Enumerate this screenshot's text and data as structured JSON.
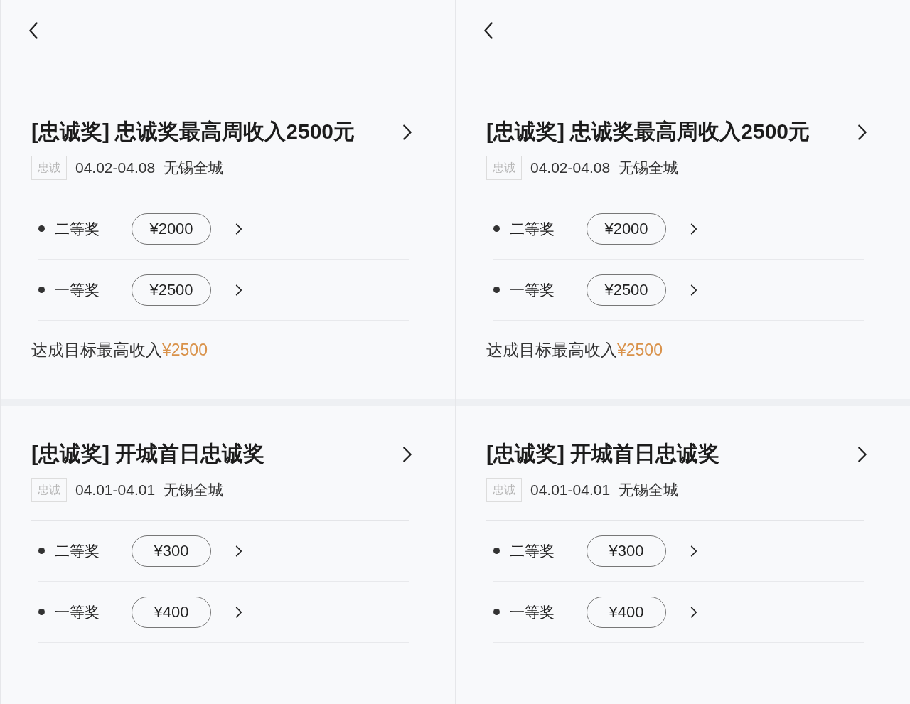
{
  "screens": [
    {
      "cards": [
        {
          "title": "[忠诚奖] 忠诚奖最高周收入2500元",
          "tag": "忠诚",
          "dates": "04.02-04.08",
          "area": "无锡全城",
          "tiers": [
            {
              "label": "二等奖",
              "amount": "¥2000"
            },
            {
              "label": "一等奖",
              "amount": "¥2500"
            }
          ],
          "footer": {
            "text": "达成目标最高收入",
            "amount": "¥2500"
          }
        },
        {
          "title": "[忠诚奖] 开城首日忠诚奖",
          "tag": "忠诚",
          "dates": "04.01-04.01",
          "area": "无锡全城",
          "tiers": [
            {
              "label": "二等奖",
              "amount": "¥300"
            },
            {
              "label": "一等奖",
              "amount": "¥400"
            }
          ]
        }
      ]
    },
    {
      "cards": [
        {
          "title": "[忠诚奖] 忠诚奖最高周收入2500元",
          "tag": "忠诚",
          "dates": "04.02-04.08",
          "area": "无锡全城",
          "tiers": [
            {
              "label": "二等奖",
              "amount": "¥2000"
            },
            {
              "label": "一等奖",
              "amount": "¥2500"
            }
          ],
          "footer": {
            "text": "达成目标最高收入",
            "amount": "¥2500"
          }
        },
        {
          "title": "[忠诚奖] 开城首日忠诚奖",
          "tag": "忠诚",
          "dates": "04.01-04.01",
          "area": "无锡全城",
          "tiers": [
            {
              "label": "二等奖",
              "amount": "¥300"
            },
            {
              "label": "一等奖",
              "amount": "¥400"
            }
          ]
        }
      ]
    }
  ]
}
